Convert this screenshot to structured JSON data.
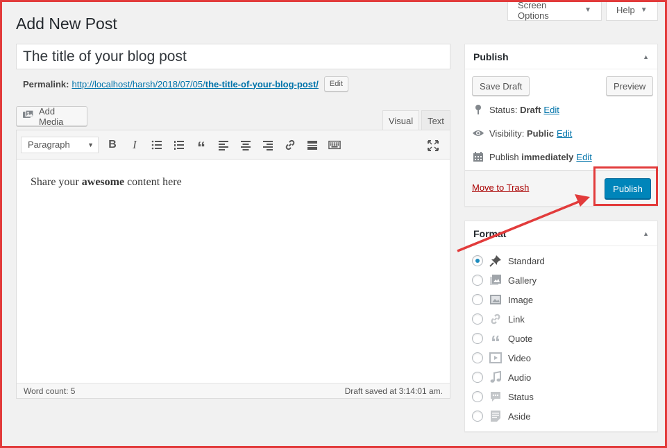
{
  "header": {
    "screen_options": "Screen Options",
    "help": "Help",
    "page_title": "Add New Post"
  },
  "post": {
    "title": "The title of your blog post",
    "permalink_label": "Permalink:",
    "permalink_base": "http://localhost/harsh/2018/07/05/",
    "permalink_slug": "the-title-of-your-blog-post/",
    "permalink_edit": "Edit"
  },
  "editor": {
    "add_media": "Add Media",
    "tab_visual": "Visual",
    "tab_text": "Text",
    "format_select": "Paragraph",
    "content_before": "Share your ",
    "content_bold": "awesome",
    "content_after": " content here",
    "word_count": "Word count: 5",
    "draft_saved": "Draft saved at 3:14:01 am."
  },
  "publish_box": {
    "title": "Publish",
    "save_draft": "Save Draft",
    "preview": "Preview",
    "status_label": "Status: ",
    "status_value": "Draft",
    "visibility_label": "Visibility: ",
    "visibility_value": "Public",
    "publish_label": "Publish ",
    "publish_value": "immediately",
    "edit": "Edit",
    "move_to_trash": "Move to Trash",
    "publish_button": "Publish"
  },
  "format_box": {
    "title": "Format",
    "selected": "Standard",
    "options": [
      "Standard",
      "Gallery",
      "Image",
      "Link",
      "Quote",
      "Video",
      "Audio",
      "Status",
      "Aside"
    ]
  },
  "colors": {
    "accent": "#0085ba",
    "link": "#0073aa",
    "annotation": "#e23b3b"
  }
}
